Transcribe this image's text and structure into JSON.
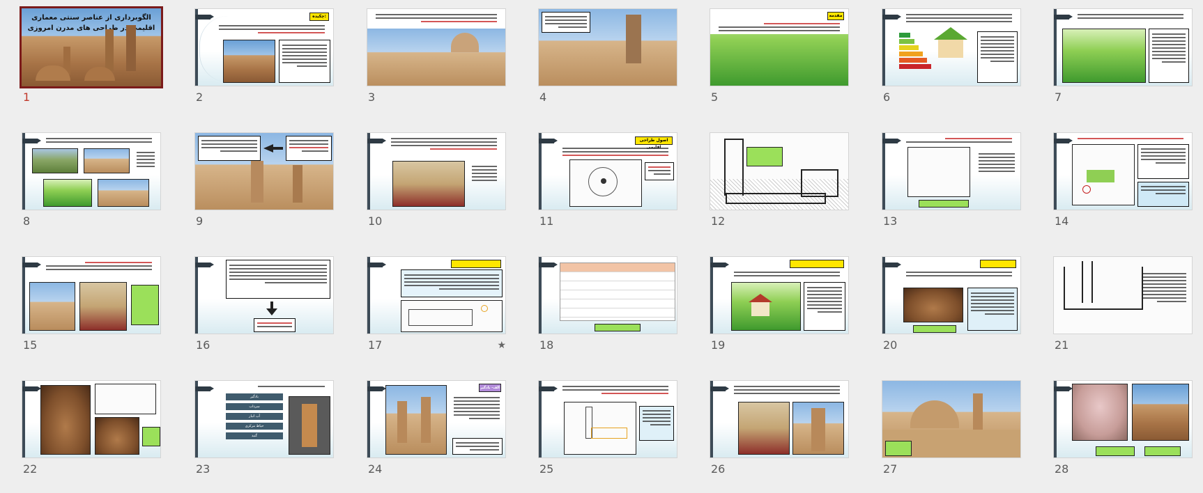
{
  "slides": [
    {
      "number": "1",
      "title_line1": "الگوبرداری از عناصر سنتی معماری",
      "title_line2": "اقلیمی در طراحی های مدرن امروزی"
    },
    {
      "number": "2",
      "label": "چکیده:"
    },
    {
      "number": "3"
    },
    {
      "number": "4"
    },
    {
      "number": "5",
      "label": "مقدمه"
    },
    {
      "number": "6"
    },
    {
      "number": "7"
    },
    {
      "number": "8"
    },
    {
      "number": "9"
    },
    {
      "number": "10"
    },
    {
      "number": "11",
      "label": "اصول طراحی اقلیمی"
    },
    {
      "number": "12"
    },
    {
      "number": "13"
    },
    {
      "number": "14"
    },
    {
      "number": "15"
    },
    {
      "number": "16"
    },
    {
      "number": "17"
    },
    {
      "number": "18"
    },
    {
      "number": "19"
    },
    {
      "number": "20"
    },
    {
      "number": "21"
    },
    {
      "number": "22"
    },
    {
      "number": "23",
      "buttons": [
        "بادگیر",
        "سرداب",
        "آب انبار",
        "حیاط مرکزی",
        "گنبد"
      ]
    },
    {
      "number": "24",
      "label": "الف- بادگیر"
    },
    {
      "number": "25"
    },
    {
      "number": "26"
    },
    {
      "number": "27"
    },
    {
      "number": "28"
    }
  ],
  "selected_slide": "1",
  "marked_slide_icon": "star-icon",
  "colors": {
    "selection_border": "#7b1a1a",
    "selected_number": "#c1392b",
    "label_yellow": "#ffe600",
    "label_green": "#9be05a"
  }
}
